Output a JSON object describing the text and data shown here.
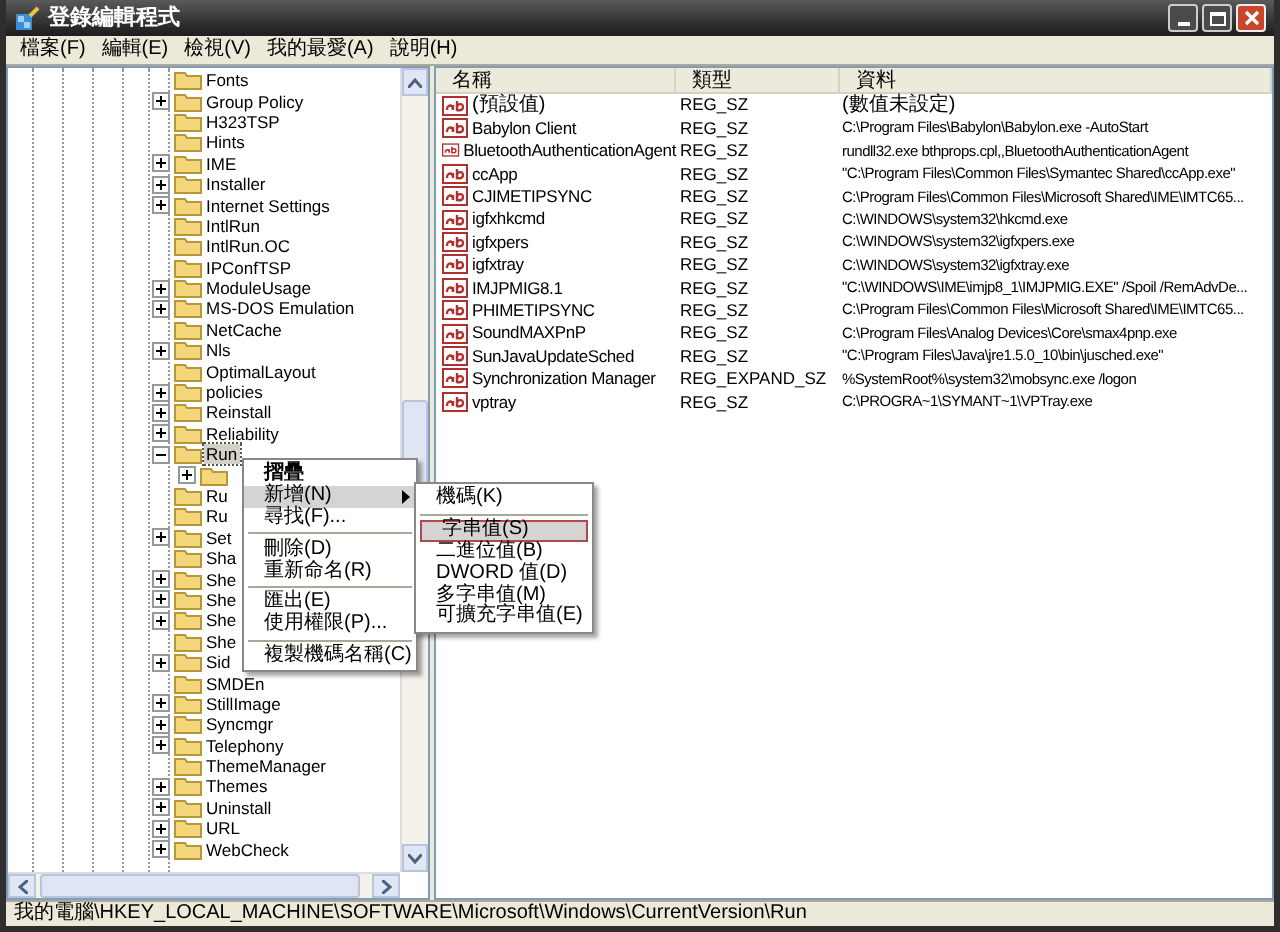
{
  "window": {
    "title": "登錄編輯程式"
  },
  "menu_bar": [
    "檔案(F)",
    "編輯(E)",
    "檢視(V)",
    "我的最愛(A)",
    "說明(H)"
  ],
  "tree": [
    {
      "label": "Fonts",
      "expandable": false,
      "selected": false
    },
    {
      "label": "Group Policy",
      "expandable": true,
      "selected": false
    },
    {
      "label": "H323TSP",
      "expandable": false,
      "selected": false
    },
    {
      "label": "Hints",
      "expandable": false,
      "selected": false
    },
    {
      "label": "IME",
      "expandable": true,
      "selected": false
    },
    {
      "label": "Installer",
      "expandable": true,
      "selected": false
    },
    {
      "label": "Internet Settings",
      "expandable": true,
      "selected": false
    },
    {
      "label": "IntlRun",
      "expandable": false,
      "selected": false
    },
    {
      "label": "IntlRun.OC",
      "expandable": false,
      "selected": false
    },
    {
      "label": "IPConfTSP",
      "expandable": false,
      "selected": false
    },
    {
      "label": "ModuleUsage",
      "expandable": true,
      "selected": false
    },
    {
      "label": "MS-DOS Emulation",
      "expandable": true,
      "selected": false
    },
    {
      "label": "NetCache",
      "expandable": false,
      "selected": false
    },
    {
      "label": "Nls",
      "expandable": true,
      "selected": false
    },
    {
      "label": "OptimalLayout",
      "expandable": false,
      "selected": false
    },
    {
      "label": "policies",
      "expandable": true,
      "selected": false
    },
    {
      "label": "Reinstall",
      "expandable": true,
      "selected": false
    },
    {
      "label": "Reliability",
      "expandable": true,
      "selected": false
    },
    {
      "label": "Run",
      "expandable": true,
      "expanded": true,
      "selected": true,
      "children": [
        {
          "expandable": true
        }
      ]
    },
    {
      "label": "Ru",
      "expandable": false,
      "selected": false
    },
    {
      "label": "Ru",
      "expandable": false,
      "selected": false
    },
    {
      "label": "Set",
      "expandable": true,
      "selected": false
    },
    {
      "label": "Sha",
      "expandable": false,
      "selected": false
    },
    {
      "label": "She",
      "expandable": true,
      "selected": false
    },
    {
      "label": "She",
      "expandable": true,
      "selected": false
    },
    {
      "label": "She",
      "expandable": true,
      "selected": false
    },
    {
      "label": "She",
      "expandable": false,
      "selected": false
    },
    {
      "label": "Sid",
      "expandable": true,
      "selected": false
    },
    {
      "label": "SMDEn",
      "expandable": false,
      "selected": false
    },
    {
      "label": "StillImage",
      "expandable": true,
      "selected": false
    },
    {
      "label": "Syncmgr",
      "expandable": true,
      "selected": false
    },
    {
      "label": "Telephony",
      "expandable": true,
      "selected": false
    },
    {
      "label": "ThemeManager",
      "expandable": false,
      "selected": false
    },
    {
      "label": "Themes",
      "expandable": true,
      "selected": false
    },
    {
      "label": "Uninstall",
      "expandable": true,
      "selected": false
    },
    {
      "label": "URL",
      "expandable": true,
      "selected": false
    },
    {
      "label": "WebCheck",
      "expandable": true,
      "selected": false
    }
  ],
  "table": {
    "columns": [
      "名稱",
      "類型",
      "資料"
    ],
    "rows": [
      [
        "(預設值)",
        "REG_SZ",
        "(數值未設定)"
      ],
      [
        "Babylon Client",
        "REG_SZ",
        "C:\\Program Files\\Babylon\\Babylon.exe -AutoStart"
      ],
      [
        "BluetoothAuthenticationAgent",
        "REG_SZ",
        "rundll32.exe bthprops.cpl,,BluetoothAuthenticationAgent"
      ],
      [
        "ccApp",
        "REG_SZ",
        "\"C:\\Program Files\\Common Files\\Symantec Shared\\ccApp.exe\""
      ],
      [
        "CJIMETIPSYNC",
        "REG_SZ",
        "C:\\Program Files\\Common Files\\Microsoft Shared\\IME\\IMTC65..."
      ],
      [
        "igfxhkcmd",
        "REG_SZ",
        "C:\\WINDOWS\\system32\\hkcmd.exe"
      ],
      [
        "igfxpers",
        "REG_SZ",
        "C:\\WINDOWS\\system32\\igfxpers.exe"
      ],
      [
        "igfxtray",
        "REG_SZ",
        "C:\\WINDOWS\\system32\\igfxtray.exe"
      ],
      [
        "IMJPMIG8.1",
        "REG_SZ",
        "\"C:\\WINDOWS\\IME\\imjp8_1\\IMJPMIG.EXE\" /Spoil /RemAdvDe..."
      ],
      [
        "PHIMETIPSYNC",
        "REG_SZ",
        "C:\\Program Files\\Common Files\\Microsoft Shared\\IME\\IMTC65..."
      ],
      [
        "SoundMAXPnP",
        "REG_SZ",
        "C:\\Program Files\\Analog Devices\\Core\\smax4pnp.exe"
      ],
      [
        "SunJavaUpdateSched",
        "REG_SZ",
        "\"C:\\Program Files\\Java\\jre1.5.0_10\\bin\\jusched.exe\""
      ],
      [
        "Synchronization Manager",
        "REG_EXPAND_SZ",
        "%SystemRoot%\\system32\\mobsync.exe /logon"
      ],
      [
        "vptray",
        "REG_SZ",
        "C:\\PROGRA~1\\SYMANT~1\\VPTray.exe"
      ]
    ]
  },
  "context_menu": [
    {
      "kind": "item",
      "label": "摺疊",
      "bold": true,
      "selected": false
    },
    {
      "kind": "item",
      "label": "新增(N)",
      "submenu": true,
      "selected": true
    },
    {
      "kind": "item",
      "label": "尋找(F)...",
      "selected": false
    },
    {
      "kind": "separator"
    },
    {
      "kind": "item",
      "label": "刪除(D)",
      "selected": false
    },
    {
      "kind": "item",
      "label": "重新命名(R)",
      "selected": false
    },
    {
      "kind": "separator"
    },
    {
      "kind": "item",
      "label": "匯出(E)",
      "selected": false
    },
    {
      "kind": "item",
      "label": "使用權限(P)...",
      "selected": false
    },
    {
      "kind": "separator"
    },
    {
      "kind": "item",
      "label": "複製機碼名稱(C)",
      "selected": false
    }
  ],
  "submenu": [
    {
      "kind": "item",
      "label": "機碼(K)",
      "selected": false
    },
    {
      "kind": "separator"
    },
    {
      "kind": "item",
      "label": "字串值(S)",
      "selected": true
    },
    {
      "kind": "item",
      "label": "二進位值(B)",
      "selected": false
    },
    {
      "kind": "item",
      "label": "DWORD 值(D)",
      "selected": false
    },
    {
      "kind": "item",
      "label": "多字串值(M)",
      "selected": false
    },
    {
      "kind": "item",
      "label": "可擴充字串值(E)",
      "selected": false
    }
  ],
  "status_bar": "我的電腦\\HKEY_LOCAL_MACHINE\\SOFTWARE\\Microsoft\\Windows\\CurrentVersion\\Run"
}
